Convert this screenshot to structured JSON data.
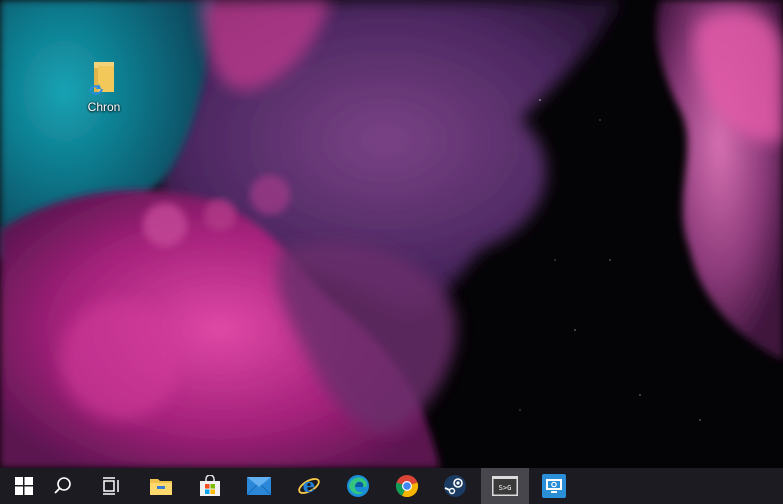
{
  "desktop": {
    "icons": [
      {
        "label": "Chron",
        "icon": "folder-sync-icon"
      }
    ]
  },
  "taskbar": {
    "items": [
      {
        "icon": "windows-start-icon"
      },
      {
        "icon": "search-icon"
      },
      {
        "icon": "task-view-icon"
      },
      {
        "icon": "file-explorer-icon"
      },
      {
        "icon": "microsoft-store-icon"
      },
      {
        "icon": "mail-icon"
      },
      {
        "icon": "internet-explorer-icon"
      },
      {
        "icon": "edge-icon"
      },
      {
        "icon": "chrome-icon"
      },
      {
        "icon": "steam-icon"
      },
      {
        "icon": "terminal-app-icon",
        "text": "S>G",
        "state": "active"
      },
      {
        "icon": "remote-desktop-icon"
      }
    ]
  },
  "colors": {
    "taskbar": "#1c1b22",
    "taskbar_active": "#47464c",
    "wallpaper_teal": "#0f7c8c",
    "wallpaper_magenta": "#b0267a",
    "wallpaper_purple": "#5a2a6a"
  }
}
